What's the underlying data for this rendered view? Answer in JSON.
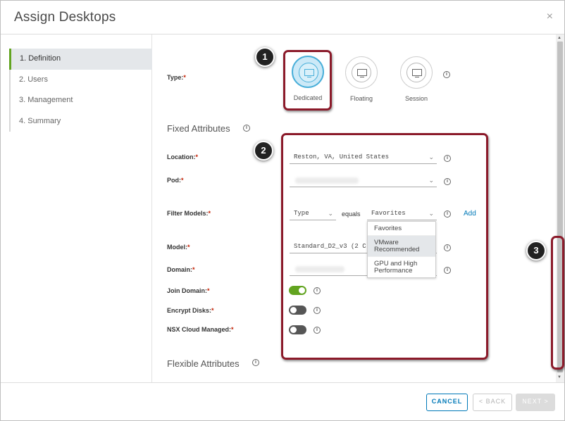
{
  "dialog": {
    "title": "Assign Desktops",
    "close_glyph": "×"
  },
  "sidebar": {
    "steps": [
      {
        "label": "1. Definition",
        "active": true
      },
      {
        "label": "2. Users",
        "active": false
      },
      {
        "label": "3. Management",
        "active": false
      },
      {
        "label": "4. Summary",
        "active": false
      }
    ]
  },
  "form": {
    "type": {
      "label": "Type:",
      "options": [
        {
          "label": "Dedicated",
          "selected": true,
          "icon": "monitor-icon"
        },
        {
          "label": "Floating",
          "selected": false,
          "icon": "stacked-monitor-icon"
        },
        {
          "label": "Session",
          "selected": false,
          "icon": "session-monitor-icon"
        }
      ]
    },
    "fixed_attributes": {
      "heading": "Fixed Attributes",
      "location": {
        "label": "Location:",
        "value": "Reston, VA, United States"
      },
      "pod": {
        "label": "Pod:",
        "value": ""
      },
      "filter_models": {
        "label": "Filter Models:",
        "filter_by": "Type",
        "operator": "equals",
        "value": "Favorites",
        "add_label": "Add",
        "dropdown_options": [
          "Favorites",
          "VMware Recommended",
          "GPU and High Performance"
        ],
        "dropdown_highlighted": "VMware Recommended"
      },
      "model": {
        "label": "Model:",
        "value": "Standard_D2_v3 (2 C"
      },
      "domain": {
        "label": "Domain:",
        "value": ""
      },
      "join_domain": {
        "label": "Join Domain:",
        "on": true
      },
      "encrypt_disks": {
        "label": "Encrypt Disks:",
        "on": false
      },
      "nsx_cloud_managed": {
        "label": "NSX Cloud Managed:",
        "on": false
      }
    },
    "flexible_attributes": {
      "heading": "Flexible Attributes"
    },
    "required_marker": "*",
    "info_glyph": "i"
  },
  "callouts": [
    "1",
    "2",
    "3"
  ],
  "footer": {
    "cancel": "CANCEL",
    "back": "< BACK",
    "next": "NEXT >"
  },
  "colors": {
    "accent": "#0079b8",
    "callout_border": "#8b1a2a",
    "toggle_on": "#62a420",
    "selected_tile": "#49afd9"
  }
}
